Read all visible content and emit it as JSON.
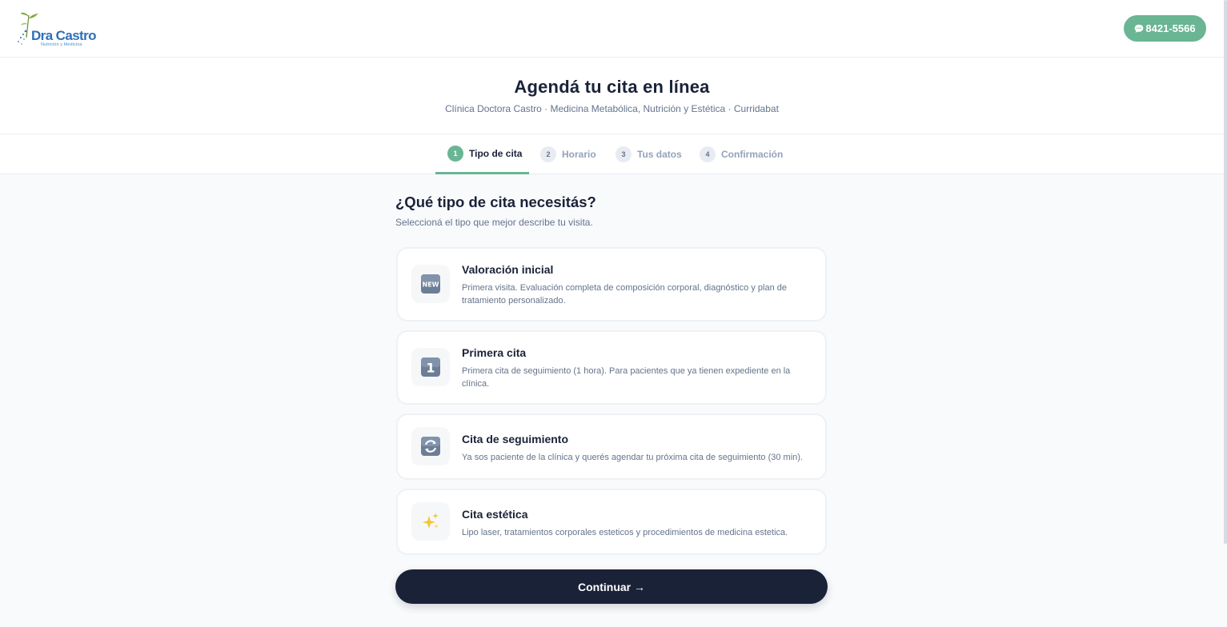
{
  "header": {
    "logo_title": "Dra Castro",
    "logo_subtitle": "Nutrición y Medicina",
    "phone_label": "8421-5566",
    "phone_icon": "chat-bubble-icon"
  },
  "hero": {
    "title": "Agendá tu cita en línea",
    "subtitle": "Clínica Doctora Castro · Medicina Metabólica, Nutrición y Estética · Curridabat"
  },
  "steps": [
    {
      "number": "1",
      "label": "Tipo de cita",
      "active": true
    },
    {
      "number": "2",
      "label": "Horario",
      "active": false
    },
    {
      "number": "3",
      "label": "Tus datos",
      "active": false
    },
    {
      "number": "4",
      "label": "Confirmación",
      "active": false
    }
  ],
  "section": {
    "title": "¿Qué tipo de cita necesitás?",
    "subtitle": "Seleccioná el tipo que mejor describe tu visita."
  },
  "options": [
    {
      "icon": "new-badge-icon",
      "title": "Valoración inicial",
      "description": "Primera visita. Evaluación completa de composición corporal, diagnóstico y plan de tratamiento personalizado."
    },
    {
      "icon": "keycap-one-icon",
      "title": "Primera cita",
      "description": "Primera cita de seguimiento (1 hora). Para pacientes que ya tienen expediente en la clínica."
    },
    {
      "icon": "refresh-arrows-icon",
      "title": "Cita de seguimiento",
      "description": "Ya sos paciente de la clínica y querés agendar tu próxima cita de seguimiento (30 min)."
    },
    {
      "icon": "sparkles-icon",
      "title": "Cita estética",
      "description": "Lipo laser, tratamientos corporales esteticos y procedimientos de medicina estetica."
    }
  ],
  "continue_label": "Continuar →",
  "colors": {
    "accent_green": "#6ab593",
    "navy": "#1a2238",
    "muted_text": "#64748b",
    "logo_blue": "#2f6fb6"
  },
  "icon_glyphs": {
    "keycap_digit": "1",
    "new_badge": "NEW"
  }
}
